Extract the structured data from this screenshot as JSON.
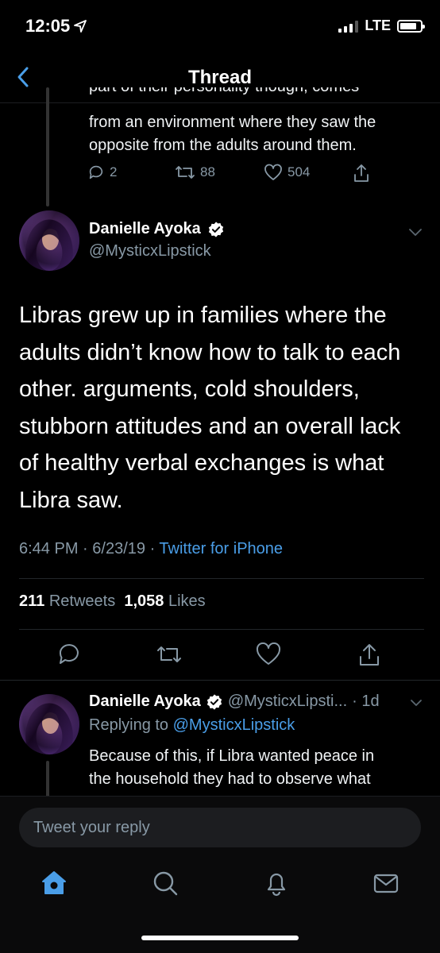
{
  "status_bar": {
    "time": "12:05",
    "network": "LTE"
  },
  "nav": {
    "title": "Thread"
  },
  "previous_tweet": {
    "text_line_1": "part of their personality though, comes",
    "text_line_2": "from an environment where they saw the",
    "text_line_3": "opposite from the adults around them.",
    "replies": "2",
    "retweets": "88",
    "likes": "504"
  },
  "main_tweet": {
    "author_name": "Danielle Ayoka",
    "handle": "@MysticxLipstick",
    "text": "Libras grew up in families where the adults didn’t know how to talk to each other. arguments, cold shoulders, stubborn attitudes and an overall lack of healthy verbal exchanges is what Libra saw.",
    "time": "6:44 PM",
    "date": "6/23/19",
    "source": "Twitter for iPhone",
    "retweet_count": "211",
    "retweet_label": "Retweets",
    "like_count": "1,058",
    "like_label": "Likes"
  },
  "reply_tweet": {
    "author_name": "Danielle Ayoka",
    "handle": "@MysticxLipsti...",
    "age": "· 1d",
    "replying_prefix": "Replying to",
    "replying_to": "@MysticxLipstick",
    "text_line_1": "Because of this, if Libra wanted peace in",
    "text_line_2": "the household they had to observe what"
  },
  "composer": {
    "placeholder": "Tweet your reply"
  },
  "colors": {
    "background": "#000000",
    "link": "#4a9ee8",
    "muted": "#8899a6",
    "accent": "#4a9ee8"
  }
}
